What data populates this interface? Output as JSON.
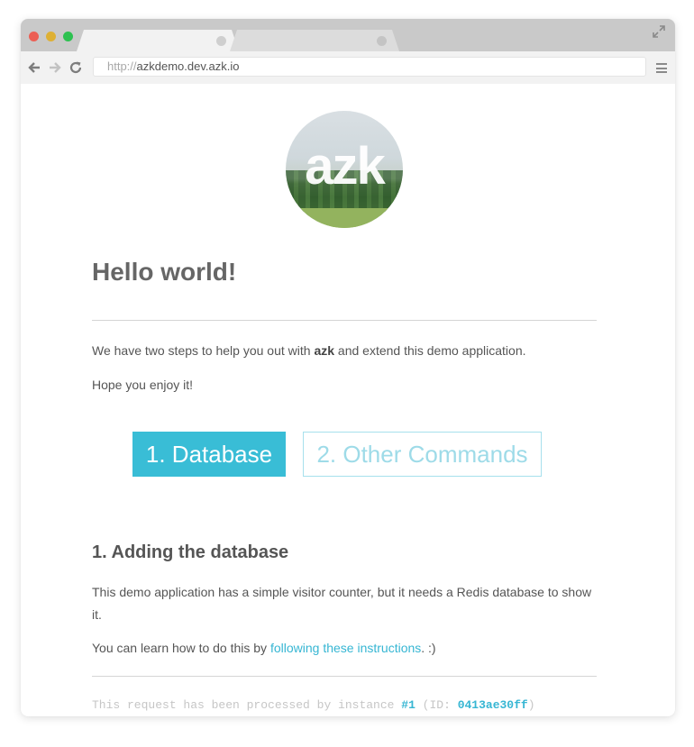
{
  "browser": {
    "url_protocol": "http://",
    "url_host": "azkdemo.dev.azk.io"
  },
  "logo": {
    "text": "azk"
  },
  "page": {
    "title": "Hello world!",
    "intro_before": "We have two steps to help you out with ",
    "intro_bold": "azk",
    "intro_after": " and extend this demo application.",
    "enjoy": "Hope you enjoy it!",
    "buttons": [
      {
        "label": "1. Database"
      },
      {
        "label": "2. Other Commands"
      }
    ],
    "section": {
      "title": "1. Adding the database",
      "description": "This demo application has a simple visitor counter, but it needs a Redis database to show it.",
      "learn_before": "You can learn how to do this by ",
      "learn_link": "following these instructions",
      "learn_after": ". :)"
    },
    "footer": {
      "prefix": "This request has been processed by instance ",
      "instance": "#1",
      "id_open": " (ID: ",
      "id": "0413ae30ff",
      "id_close": ")"
    }
  },
  "colors": {
    "accent": "#39bdd6",
    "link": "#36b6d3",
    "text": "#555555"
  }
}
